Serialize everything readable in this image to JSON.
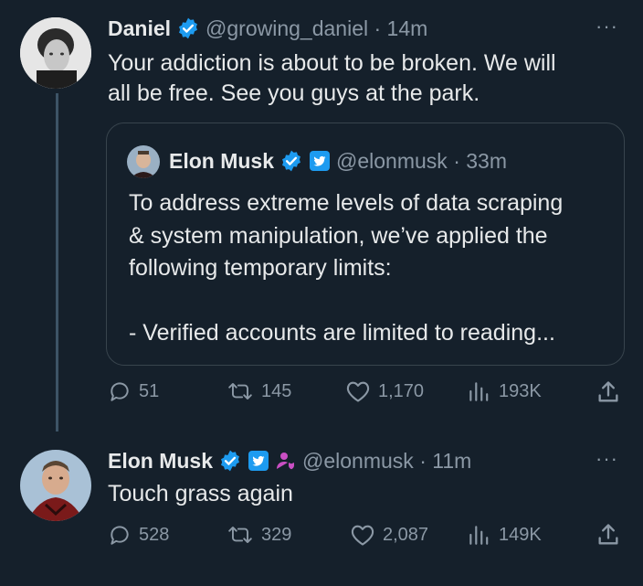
{
  "colors": {
    "background": "#15202b",
    "text_primary": "#e7e9ea",
    "text_secondary": "#8b98a5",
    "verified_blue": "#1d9bf0",
    "twitter_square_blue": "#1d9bf0",
    "staff_badge_magenta": "#c94fc3",
    "border": "#38444d"
  },
  "tweet1": {
    "author_name": "Daniel",
    "verified_icon": "blue-check-icon",
    "handle_time": "@growing_daniel · 14m",
    "text_line1": "Your addiction is about to be broken. We will",
    "text_line2": "all be free. See you guys at the park.",
    "more": "···",
    "quoted": {
      "author_name": "Elon Musk",
      "handle_time": "@elonmusk · 33m",
      "lines": [
        "To address extreme levels of data scraping",
        "& system manipulation, we’ve applied the",
        "following temporary limits:",
        "",
        "- Verified accounts are limited to reading..."
      ]
    },
    "actions": {
      "replies": "51",
      "retweets": "145",
      "likes": "1,170",
      "views": "193K"
    }
  },
  "tweet2": {
    "author_name": "Elon Musk",
    "handle_time": "@elonmusk · 11m",
    "text": "Touch grass again",
    "more": "···",
    "actions": {
      "replies": "528",
      "retweets": "329",
      "likes": "2,087",
      "views": "149K"
    }
  }
}
